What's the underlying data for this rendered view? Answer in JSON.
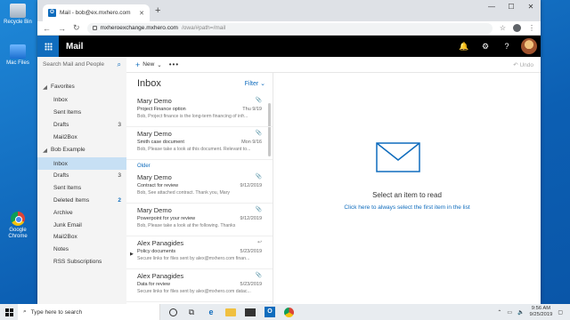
{
  "desktop": {
    "icons": [
      {
        "label": "Recycle Bin"
      },
      {
        "label": "Mac Files"
      },
      {
        "label": "Google Chrome"
      }
    ]
  },
  "browser": {
    "tab_title": "Mail - bob@ex.mxhero.com",
    "tab_favicon": "O",
    "url_host": "mxheroexchange.mxhero.com",
    "url_path": "/owa/#path=/mail",
    "controls": {
      "minimize": "—",
      "maximize": "☐",
      "close": "✕"
    }
  },
  "owa": {
    "app_title": "Mail",
    "accent": "#0f6cbd",
    "search_placeholder": "Search Mail and People",
    "new_label": "New",
    "undo_label": "Undo",
    "nav": {
      "favorites_label": "Favorites",
      "favorites": [
        {
          "label": "Inbox",
          "count": ""
        },
        {
          "label": "Sent Items",
          "count": ""
        },
        {
          "label": "Drafts",
          "count": "3"
        },
        {
          "label": "Mail2Box",
          "count": ""
        }
      ],
      "account_label": "Bob Example",
      "folders": [
        {
          "label": "Inbox",
          "count": ""
        },
        {
          "label": "Drafts",
          "count": "3"
        },
        {
          "label": "Sent Items",
          "count": ""
        },
        {
          "label": "Deleted Items",
          "count": "2"
        },
        {
          "label": "Archive",
          "count": ""
        },
        {
          "label": "Junk Email",
          "count": ""
        },
        {
          "label": "Mail2Box",
          "count": ""
        },
        {
          "label": "Notes",
          "count": ""
        },
        {
          "label": "RSS Subscriptions",
          "count": ""
        }
      ]
    },
    "list": {
      "title": "Inbox",
      "filter_label": "Filter",
      "older_label": "Older",
      "messages": [
        {
          "from": "Mary Demo",
          "subject": "Project Finance option",
          "date": "Thu 9/19",
          "preview": "Bob, Project finance is the long-term financing of infr..."
        },
        {
          "from": "Mary Demo",
          "subject": "Smith case document",
          "date": "Mon 9/16",
          "preview": "Bob, Please take a look at this document. Relevant to..."
        },
        {
          "from": "Mary Demo",
          "subject": "Contract for review",
          "date": "9/12/2019",
          "preview": "Bob, See attached contract. Thank you, Mary"
        },
        {
          "from": "Mary Demo",
          "subject": "Powerpoint for your review",
          "date": "9/12/2019",
          "preview": "Bob, Please take a look at the following. Thanks"
        },
        {
          "from": "Alex Panagides",
          "subject": "Policy documents",
          "date": "5/23/2019",
          "preview": "Secure links for files sent by alex@mxhero.com finan..."
        },
        {
          "from": "Alex Panagides",
          "subject": "Data for review",
          "date": "5/23/2019",
          "preview": "Secure links for files sent by alex@mxhero.com datac..."
        }
      ]
    },
    "reading": {
      "empty_text": "Select an item to read",
      "link_text": "Click here to always select the first item in the list"
    }
  },
  "taskbar": {
    "search_placeholder": "Type here to search",
    "time": "9:56 AM",
    "date": "9/25/2019"
  }
}
